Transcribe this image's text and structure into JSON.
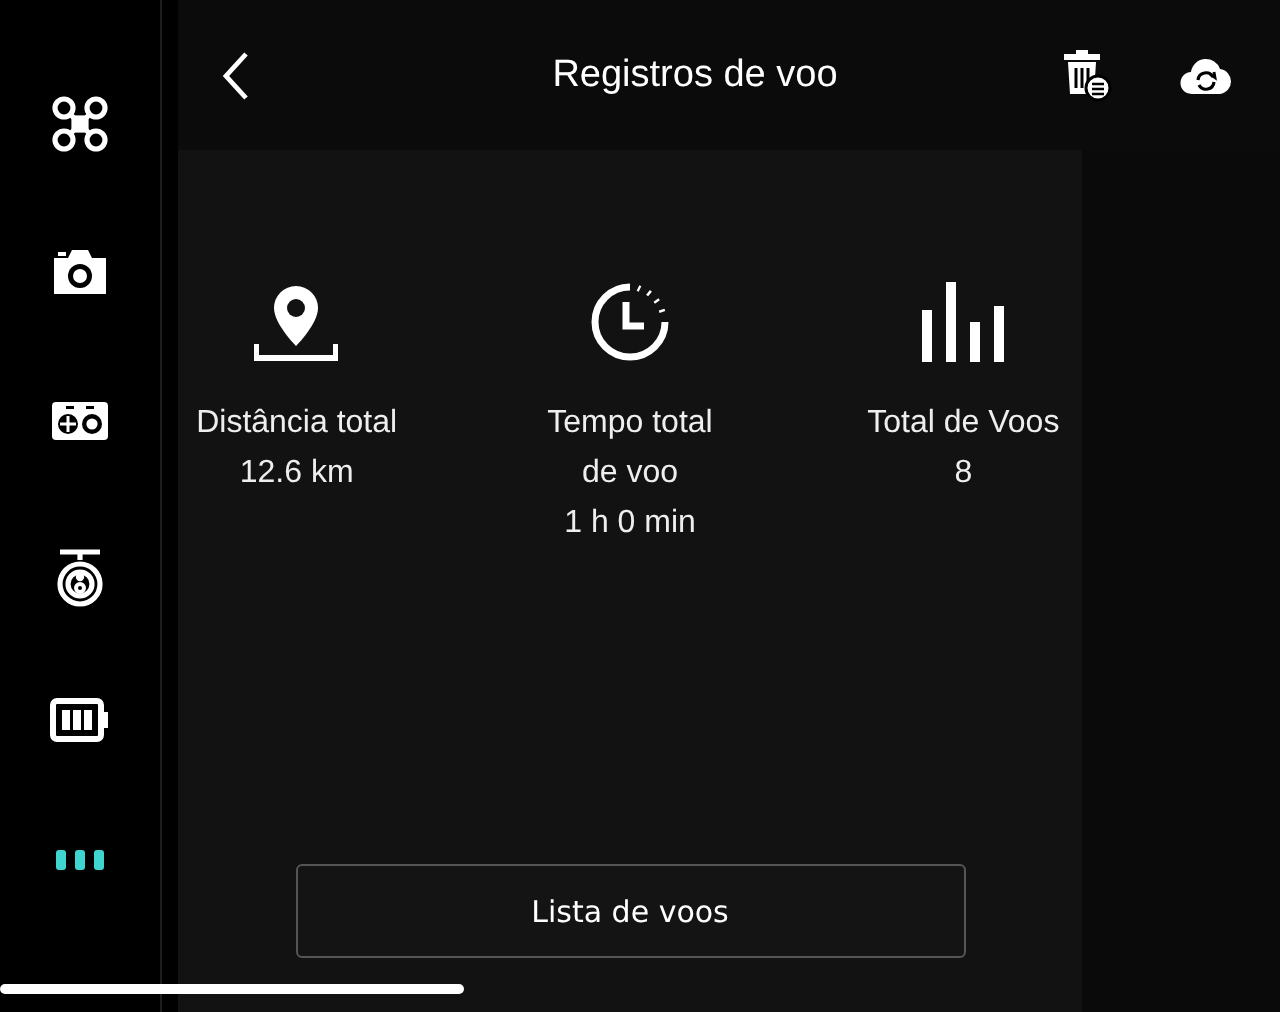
{
  "sidebar": {
    "items": [
      {
        "kind": "drone",
        "selected": false
      },
      {
        "kind": "camera",
        "selected": false
      },
      {
        "kind": "gimbal",
        "selected": false
      },
      {
        "kind": "lens",
        "selected": false
      },
      {
        "kind": "battery",
        "selected": false
      },
      {
        "kind": "more",
        "selected": true
      }
    ]
  },
  "header": {
    "title": "Registros de voo"
  },
  "stats": [
    {
      "kind": "distance",
      "label": "Distância total",
      "value": "12.6 km"
    },
    {
      "kind": "time",
      "label": "Tempo total de voo",
      "value": "1 h 0 min"
    },
    {
      "kind": "count",
      "label": "Total de Voos",
      "value": "8"
    }
  ],
  "button": {
    "label": "Lista de voos"
  }
}
